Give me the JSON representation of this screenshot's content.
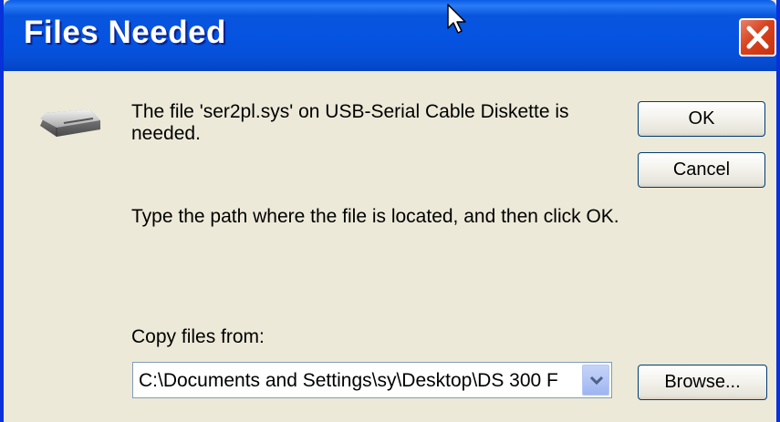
{
  "window": {
    "title": "Files Needed"
  },
  "icons": {
    "close": "close-icon",
    "disk": "disk-drive-icon",
    "dropdown": "chevron-down-icon",
    "cursor": "mouse-cursor-icon"
  },
  "message": {
    "line1": "The file 'ser2pl.sys' on USB-Serial Cable Diskette is needed.",
    "line2": "Type the path where the file is located, and then click OK."
  },
  "buttons": {
    "ok": "OK",
    "cancel": "Cancel",
    "browse": "Browse..."
  },
  "copy_from": {
    "label": "Copy files from:",
    "value": "C:\\Documents and Settings\\sy\\Desktop\\DS 300 F"
  },
  "colors": {
    "titlebar": "#0553e1",
    "dialog_background": "#ece9d8",
    "close_button": "#d8421e"
  }
}
